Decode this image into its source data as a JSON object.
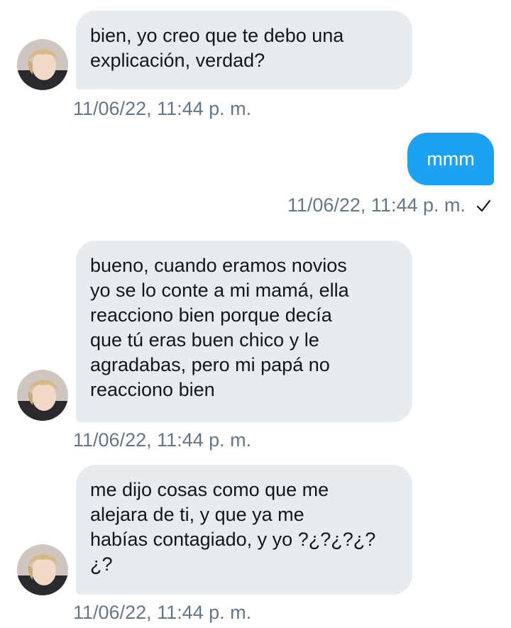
{
  "conversation": {
    "messages": [
      {
        "direction": "received",
        "text": "bien, yo creo que te debo una\nexplicación, verdad?",
        "timestamp": "11/06/22, 11:44 p. m."
      },
      {
        "direction": "sent",
        "text": "mmm",
        "timestamp": "11/06/22, 11:44 p. m.",
        "status_icon": "checkmark-icon"
      },
      {
        "direction": "received",
        "text": "bueno, cuando eramos novios\nyo se lo conte a mi mamá, ella\nreacciono bien porque decía\nque tú eras buen chico y le\nagradabas, pero mi papá no\nreacciono bien",
        "timestamp": "11/06/22, 11:44 p. m."
      },
      {
        "direction": "received",
        "text": "me dijo cosas como que me\nalejara de ti, y que ya me\nhabías contagiado, y yo ?¿?¿?¿?\n¿?",
        "timestamp": "11/06/22, 11:44 p. m."
      }
    ]
  },
  "colors": {
    "received_bubble": "#e6ecf0",
    "sent_bubble": "#1da1f2",
    "timestamp": "#657786",
    "text": "#14171a"
  }
}
